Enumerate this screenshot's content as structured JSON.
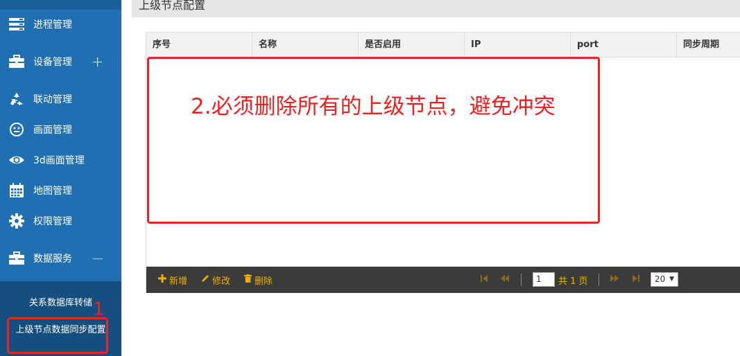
{
  "sidebar": {
    "items": [
      {
        "label": "进程管理",
        "icon": "server-icon"
      },
      {
        "label": "设备管理",
        "icon": "briefcase-icon",
        "toggle": "+"
      },
      {
        "label": "联动管理",
        "icon": "recycle-icon"
      },
      {
        "label": "画面管理",
        "icon": "smiley-icon"
      },
      {
        "label": "3d画面管理",
        "icon": "eye-icon"
      },
      {
        "label": "地图管理",
        "icon": "calendar-icon"
      },
      {
        "label": "权限管理",
        "icon": "gear-icon"
      },
      {
        "label": "数据服务",
        "icon": "briefcase-icon",
        "toggle": "—"
      }
    ],
    "submenu": [
      {
        "label": "关系数据库转储"
      },
      {
        "label": "上级节点数据同步配置"
      }
    ]
  },
  "page": {
    "title": "上级节点配置"
  },
  "grid": {
    "columns": [
      "序号",
      "名称",
      "是否启用",
      "IP",
      "port",
      "同步周期"
    ],
    "rows": []
  },
  "toolbar": {
    "add_label": "新增",
    "edit_label": "修改",
    "delete_label": "删除",
    "page_value": "1",
    "page_total_text": "共 1 页",
    "page_size": "20"
  },
  "annotations": {
    "main_text": "2.必须删除所有的上级节点，避免冲突",
    "side_number": "1"
  },
  "colors": {
    "sidebar_bg": "#1f6fb2",
    "submenu_bg": "#154f80",
    "toolbar_bg": "#3b3b3b",
    "toolbar_text": "#f0b000",
    "annotation_red": "#e82525"
  }
}
